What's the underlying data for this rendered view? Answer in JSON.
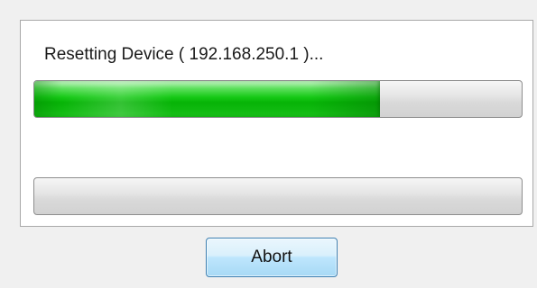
{
  "dialog": {
    "status_text": "Resetting Device ( 192.168.250.1 )...",
    "progress_primary": {
      "fraction": 0.71
    },
    "progress_secondary": {
      "fraction": 0
    },
    "abort_label": "Abort"
  },
  "colors": {
    "progress_fill": "#16c916",
    "progress_track": "#dcdcdc",
    "button_border": "#3c7fb1",
    "panel_background": "#ffffff",
    "dialog_background": "#f0f0f0"
  }
}
